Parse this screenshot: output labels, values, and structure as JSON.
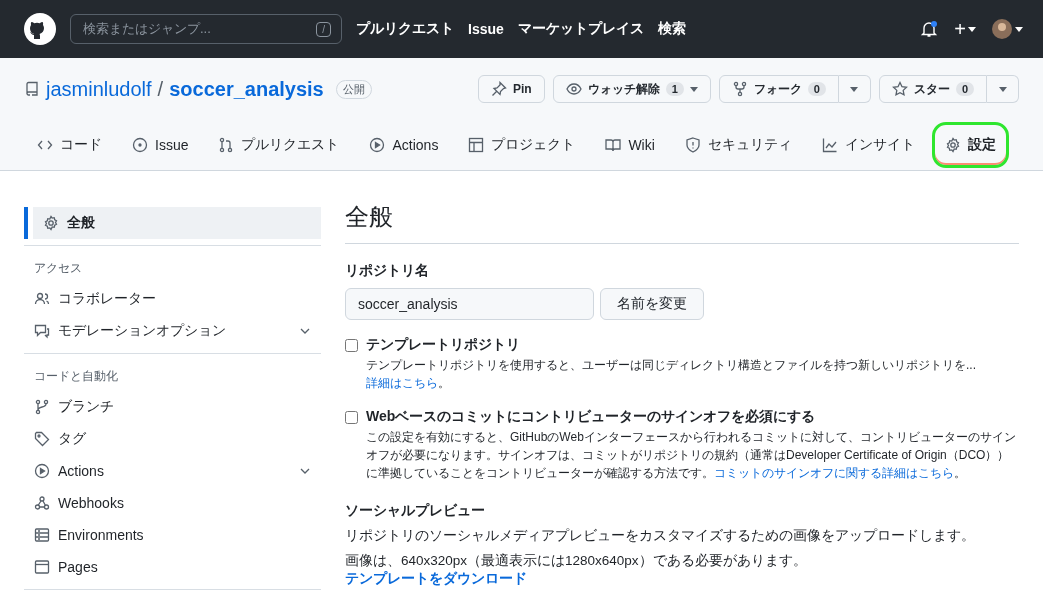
{
  "header": {
    "search_placeholder": "検索またはジャンプ...",
    "search_key": "/",
    "nav": [
      "プルリクエスト",
      "Issue",
      "マーケットプレイス",
      "検索"
    ],
    "notification_unread": true,
    "plus": "+"
  },
  "repo": {
    "owner": "jasminludolf",
    "separator": "/",
    "name": "soccer_analysis",
    "visibility": "公開",
    "actions": [
      {
        "kind": "pin",
        "label": "Pin"
      },
      {
        "kind": "watch",
        "label": "ウォッチ解除",
        "count": "1"
      },
      {
        "kind": "fork",
        "label": "フォーク",
        "count": "0"
      },
      {
        "kind": "star",
        "label": "スター",
        "count": "0"
      }
    ]
  },
  "tabs": [
    {
      "kind": "code",
      "label": "コード",
      "selected": false,
      "highlighted": false
    },
    {
      "kind": "issue",
      "label": "Issue",
      "selected": false,
      "highlighted": false
    },
    {
      "kind": "pr",
      "label": "プルリクエスト",
      "selected": false,
      "highlighted": false
    },
    {
      "kind": "play",
      "label": "Actions",
      "selected": false,
      "highlighted": false
    },
    {
      "kind": "table",
      "label": "プロジェクト",
      "selected": false,
      "highlighted": false
    },
    {
      "kind": "book",
      "label": "Wiki",
      "selected": false,
      "highlighted": false
    },
    {
      "kind": "shield",
      "label": "セキュリティ",
      "selected": false,
      "highlighted": false
    },
    {
      "kind": "graph",
      "label": "インサイト",
      "selected": false,
      "highlighted": false
    },
    {
      "kind": "gear",
      "label": "設定",
      "selected": true,
      "highlighted": true
    }
  ],
  "sidebar": {
    "groups": [
      {
        "items": [
          {
            "kind": "gear",
            "label": "全般",
            "selected": true,
            "expandable": false
          }
        ]
      },
      {
        "heading": "アクセス",
        "items": [
          {
            "kind": "people",
            "label": "コラボレーター",
            "selected": false,
            "expandable": false
          },
          {
            "kind": "comment",
            "label": "モデレーションオプション",
            "selected": false,
            "expandable": true
          }
        ]
      },
      {
        "heading": "コードと自動化",
        "items": [
          {
            "kind": "branch",
            "label": "ブランチ",
            "selected": false,
            "expandable": false
          },
          {
            "kind": "tag",
            "label": "タグ",
            "selected": false,
            "expandable": false
          },
          {
            "kind": "play",
            "label": "Actions",
            "selected": false,
            "expandable": true
          },
          {
            "kind": "webhook",
            "label": "Webhooks",
            "selected": false,
            "expandable": false
          },
          {
            "kind": "server",
            "label": "Environments",
            "selected": false,
            "expandable": false
          },
          {
            "kind": "browser",
            "label": "Pages",
            "selected": false,
            "expandable": false
          }
        ]
      }
    ]
  },
  "main": {
    "title": "全般",
    "repo_name_label": "リポジトリ名",
    "repo_name_value": "soccer_analysis",
    "rename_button": "名前を変更",
    "options": [
      {
        "label": "テンプレートリポジトリ",
        "checked": false,
        "description": "テンプレートリポジトリを使用すると、ユーザーは同じディレクトリ構造とファイルを持つ新しいリポジトリを... ",
        "link": "詳細はこちら",
        "suffix": "。"
      },
      {
        "label": "Webベースのコミットにコントリビューターのサインオフを必須にする",
        "checked": false,
        "description": "この設定を有効にすると、GitHubのWebインターフェースから行われるコミットに対して、コントリビューターのサインオフが必要になります。サインオフは、コミットがリポジトリの規約（通常はDeveloper Certificate of Origin（DCO））に準拠していることをコントリビューターが確認する方法です。",
        "link": "コミットのサインオフに関する詳細はこちら",
        "suffix": "。"
      }
    ],
    "social": {
      "title": "ソーシャルプレビュー",
      "text1": "リポジトリのソーシャルメディアプレビューをカスタマイズするための画像をアップロードします。",
      "text2": "画像は、640x320px（最適表示には1280x640px）である必要があります。",
      "link": "テンプレートをダウンロード"
    }
  }
}
